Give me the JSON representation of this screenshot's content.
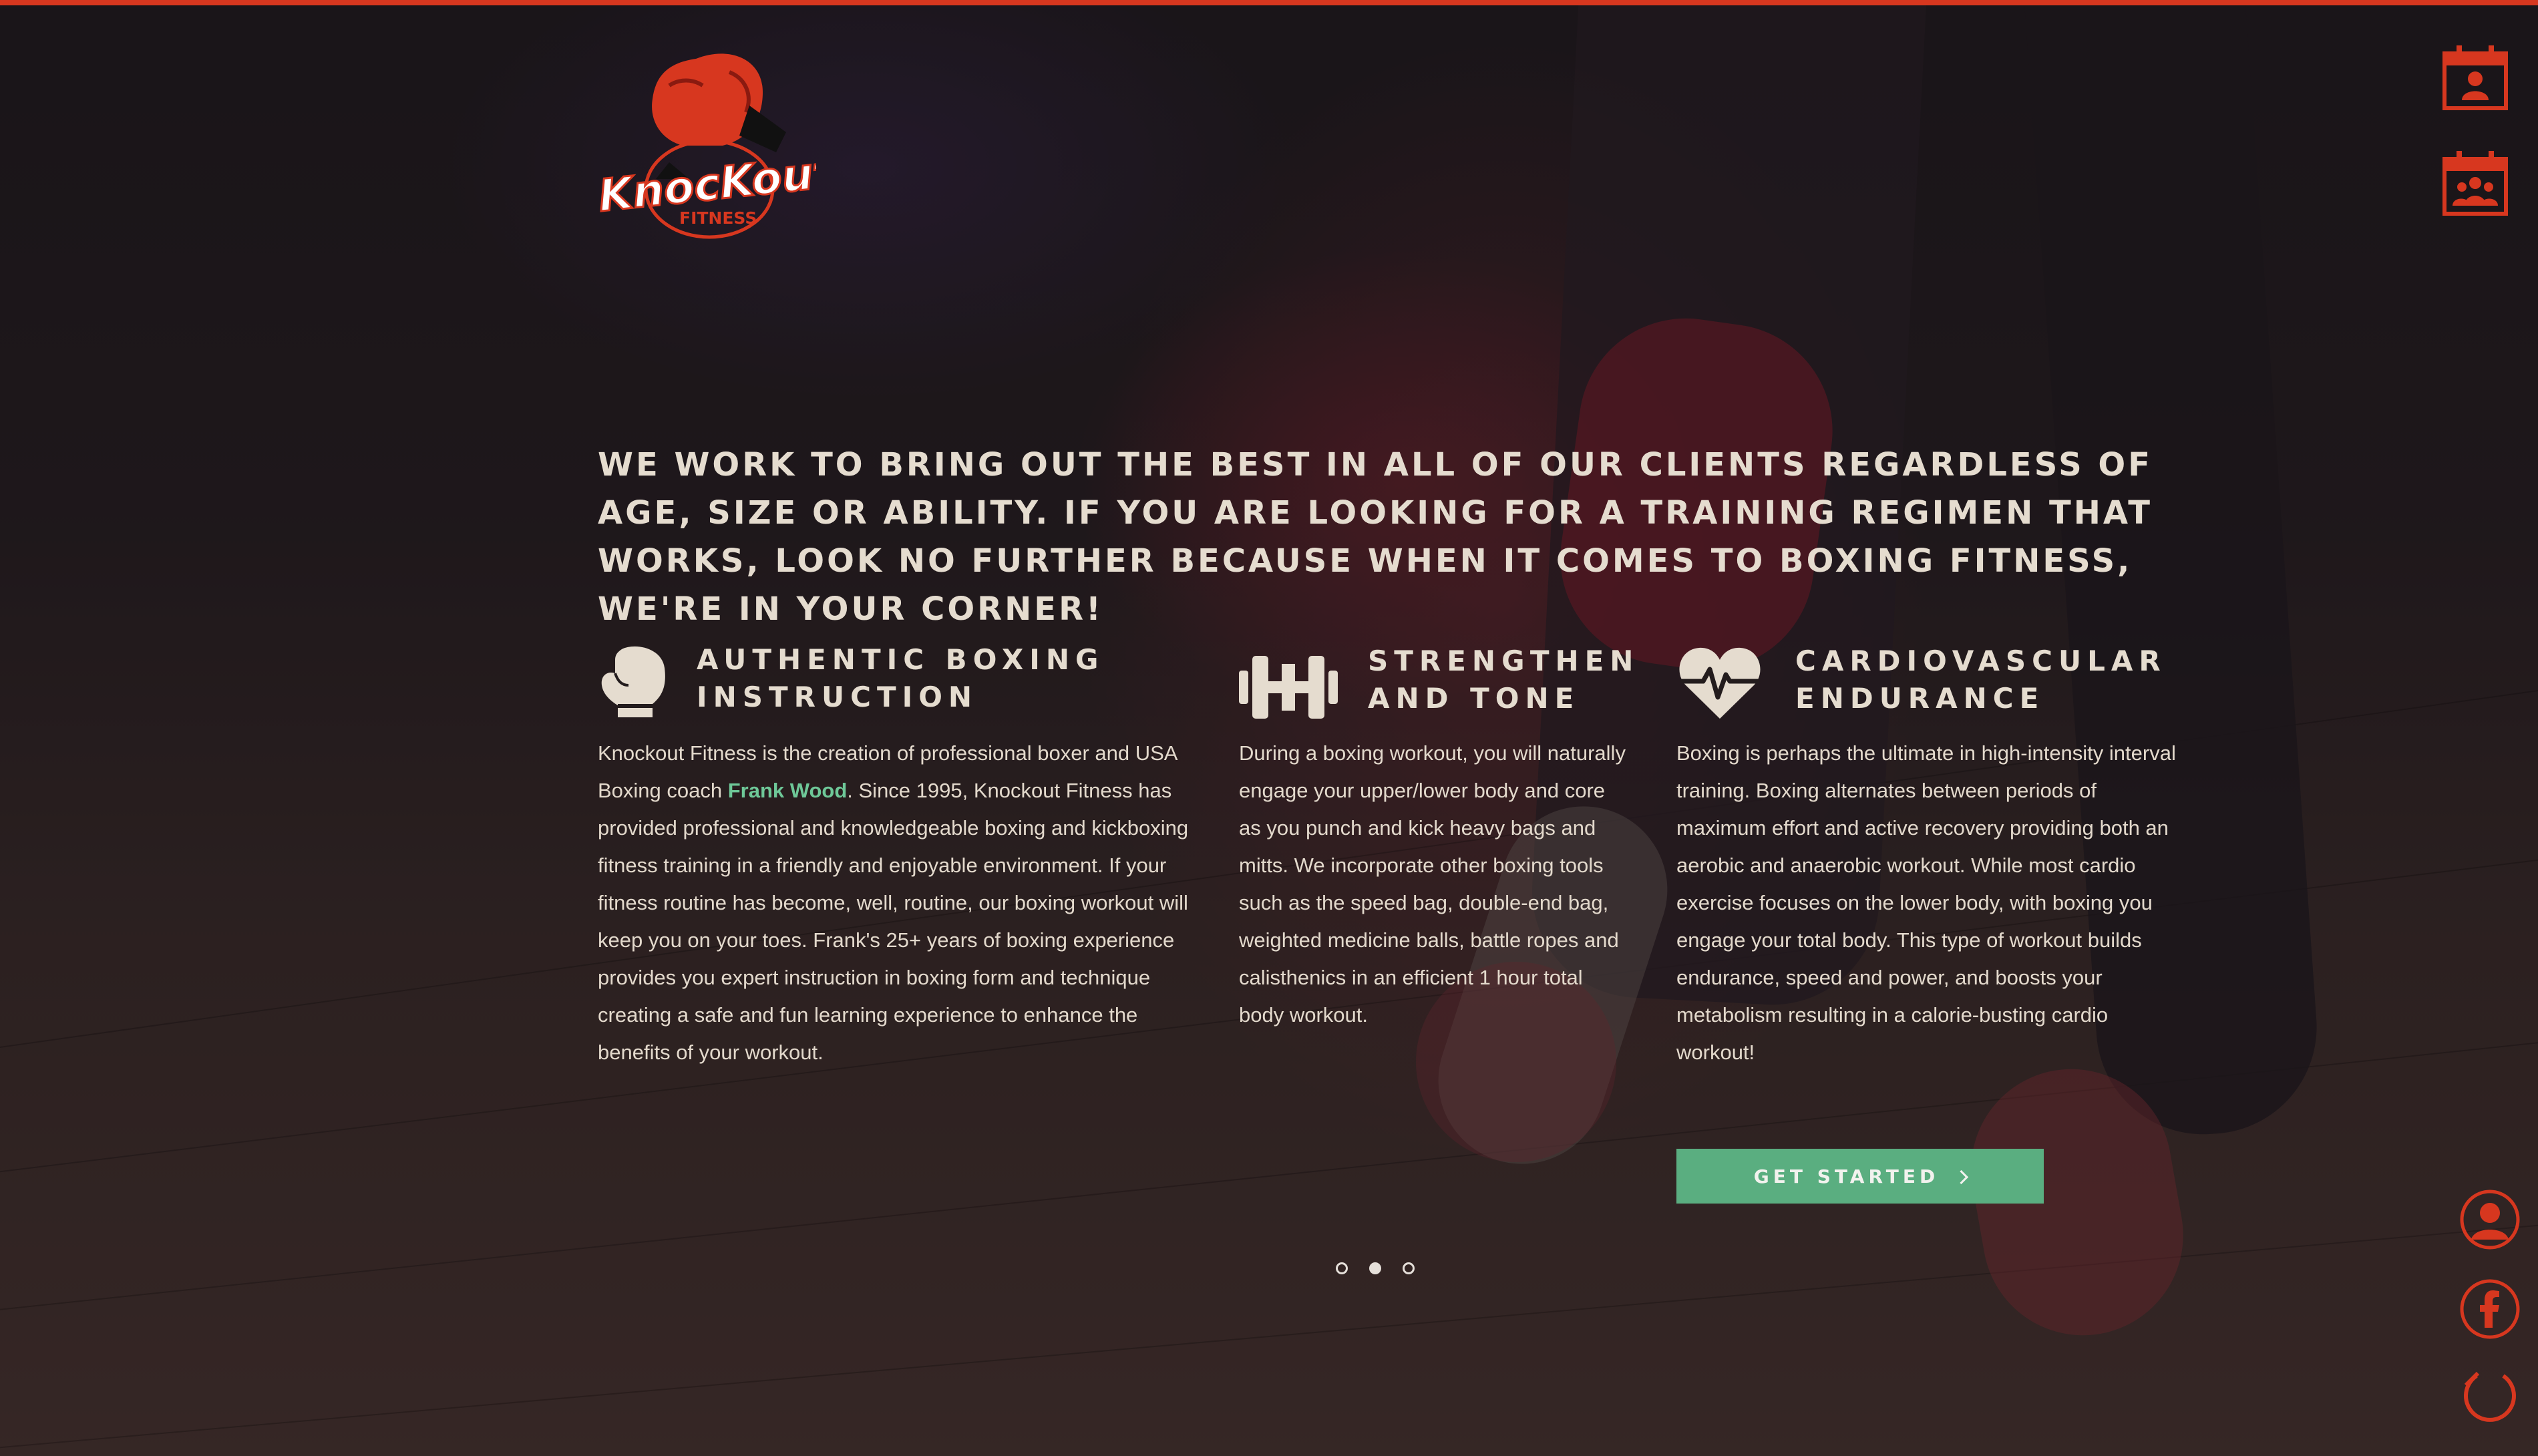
{
  "brand": {
    "name_line1": "KnocKout",
    "name_line2": "FITNESS",
    "colors": {
      "accent": "#d7371f",
      "cta": "#5aae80",
      "link": "#6ec898",
      "text": "#e5dccf"
    }
  },
  "rail": {
    "top_icons": [
      "calendar-person-icon",
      "calendar-group-icon"
    ],
    "bottom_icons": [
      "user-circle-icon",
      "facebook-icon",
      "power-icon"
    ]
  },
  "hero": {
    "headline": "We work to bring out the best in all of our clients regardless of age, size or ability.  If you are looking for a training regimen that works, look no further because when it comes to boxing fitness, we're in your corner!"
  },
  "features": [
    {
      "icon": "boxing-glove-icon",
      "title": "Authentic Boxing\nInstruction",
      "body_before": "Knockout Fitness is the creation of professional boxer and USA Boxing coach ",
      "body_link": "Frank Wood",
      "body_after": ".  Since 1995, Knockout Fitness has provided professional and knowledgeable boxing and kickboxing fitness training in a friendly and enjoyable environment.  If your fitness routine has become, well, routine, our boxing workout will keep you on your toes.  Frank's 25+ years of boxing experience provides you expert instruction in boxing form and technique creating a safe and fun learning experience to enhance the benefits of your workout."
    },
    {
      "icon": "dumbbell-icon",
      "title": "Strengthen\nand Tone",
      "body": "During a boxing workout, you will naturally engage your upper/lower body and core as you punch and kick heavy bags and mitts.  We incorporate other boxing tools such as the speed bag, double-end bag, weighted medicine balls, battle ropes and calisthenics in an efficient 1 hour total body workout."
    },
    {
      "icon": "heartbeat-icon",
      "title": "Cardiovascular\nEndurance",
      "body": "Boxing is perhaps the ultimate in high-intensity interval training.  Boxing alternates between periods of maximum effort and active recovery providing both an aerobic and anaerobic workout.  While most cardio exercise focuses on the lower body, with boxing you engage your total body.  This type of workout builds endurance, speed and power, and boosts your metabolism resulting in a calorie-busting cardio workout!"
    }
  ],
  "cta": {
    "label": "GET STARTED",
    "icon": "chevron-right-icon"
  },
  "slider": {
    "count": 3,
    "active_index": 1
  }
}
